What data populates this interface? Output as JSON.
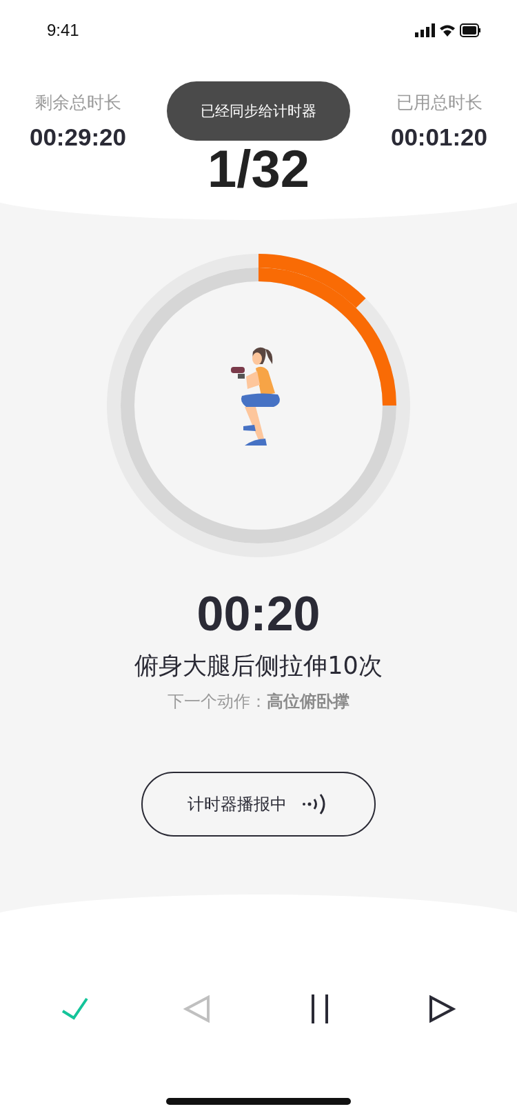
{
  "status_bar": {
    "time": "9:41"
  },
  "stats": [
    {
      "label": "剩余总时长",
      "value": "00:29:20"
    },
    {
      "label": "已用总时长",
      "value": "00:01:20"
    }
  ],
  "progress": "1/32",
  "toast": "已经同步给计时器",
  "timer": "00:20",
  "exercise": "俯身大腿后侧拉伸10次",
  "next": {
    "label": "下一个动作：",
    "name": "高位俯卧撑"
  },
  "broadcast_button": "计时器播报中",
  "controls": [
    {
      "kind": "check",
      "disabled": false
    },
    {
      "kind": "previous",
      "disabled": true
    },
    {
      "kind": "pause",
      "disabled": false
    },
    {
      "kind": "next",
      "disabled": false
    }
  ]
}
